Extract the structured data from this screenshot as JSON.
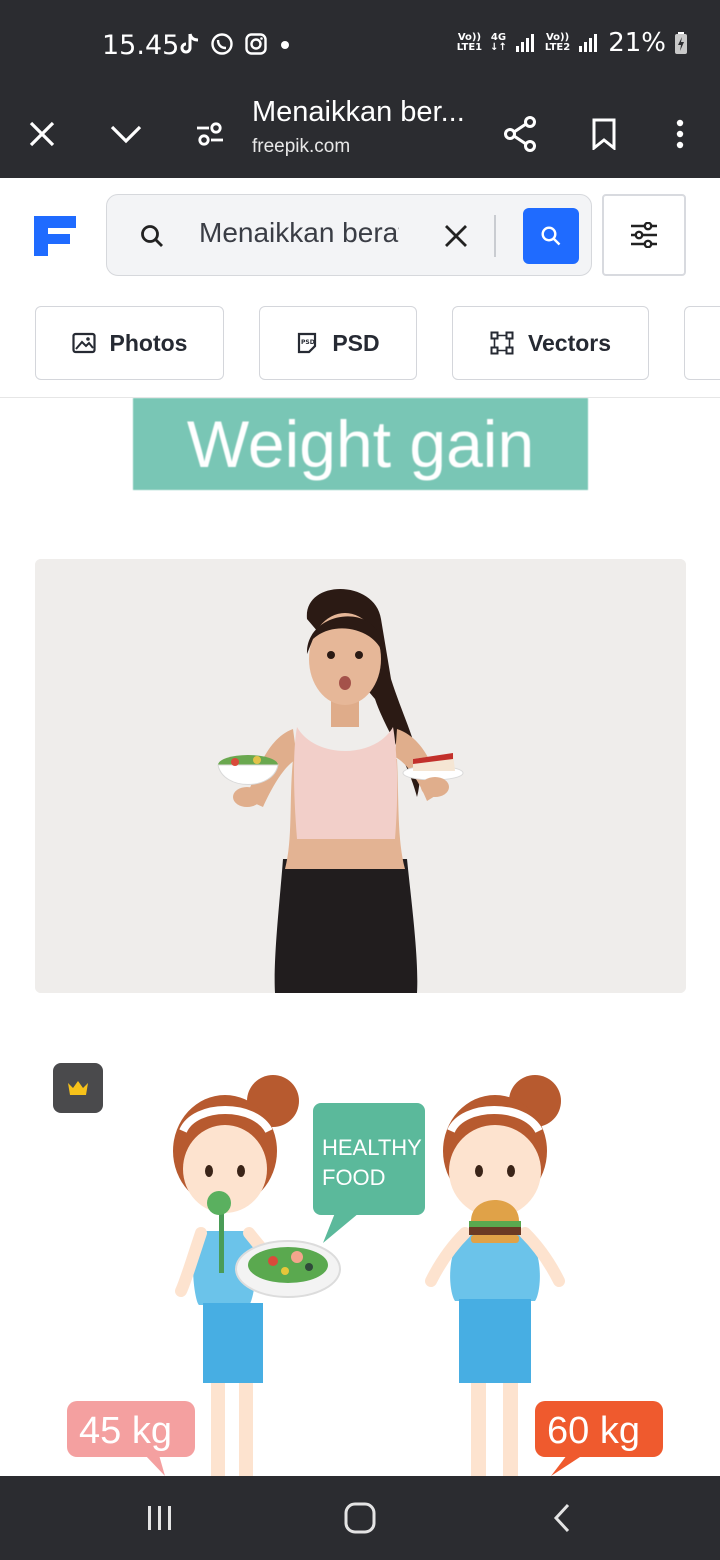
{
  "status": {
    "time": "15.45",
    "sim1_top": "Vo))",
    "sim1_bottom": "LTE1",
    "net_top": "4G",
    "net_bottom": "↓↑",
    "sim2_top": "Vo))",
    "sim2_bottom": "LTE2",
    "battery": "21%"
  },
  "browser": {
    "title": "Menaikkan ber...",
    "url": "freepik.com"
  },
  "search": {
    "query": "Menaikkan berat"
  },
  "filters": [
    {
      "label": "Photos",
      "icon": "image-icon"
    },
    {
      "label": "PSD",
      "icon": "psd-icon"
    },
    {
      "label": "Vectors",
      "icon": "vectors-icon"
    }
  ],
  "results": {
    "banner_text": "Weight gain",
    "illustration": {
      "bubble_line1": "HEALTHY",
      "bubble_line2": "FOOD",
      "left_weight": "45 kg",
      "right_weight": "60 kg"
    }
  },
  "colors": {
    "accent": "#1f6bff",
    "banner": "#79c6b5",
    "bubble": "#5bb99b",
    "left_tag": "#f4a0a0",
    "right_tag": "#ef5a2e"
  }
}
